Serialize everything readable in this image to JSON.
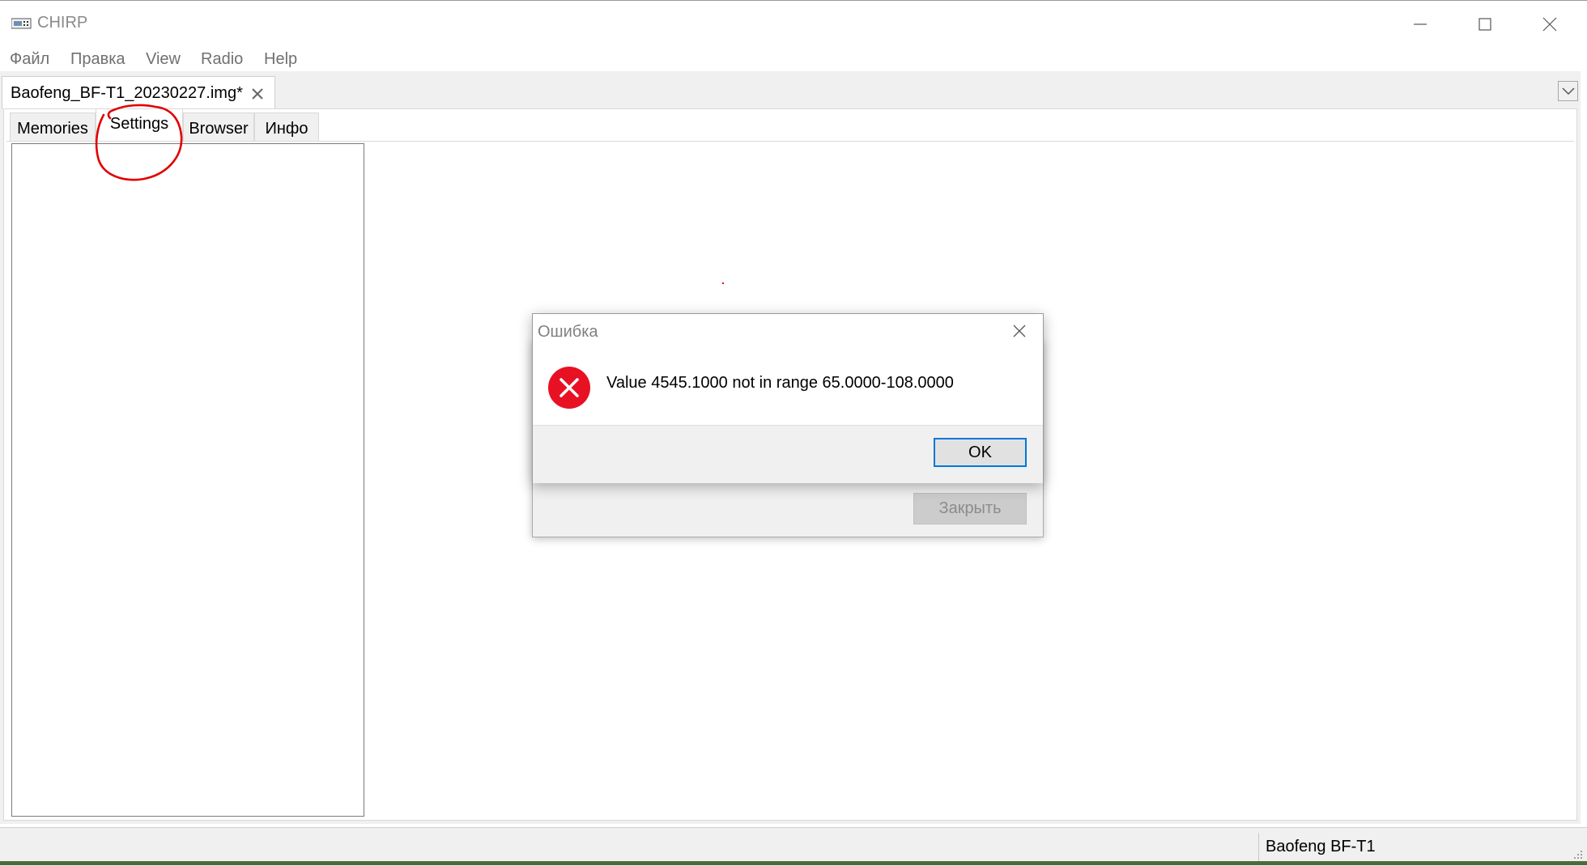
{
  "window": {
    "title": "CHIRP"
  },
  "menu": [
    "Файл",
    "Правка",
    "View",
    "Radio",
    "Help"
  ],
  "file_tab": {
    "label": "Baofeng_BF-T1_20230227.img*"
  },
  "subtabs": [
    "Memories",
    "Settings",
    "Browser",
    "Инфо"
  ],
  "active_subtab": "Settings",
  "status": {
    "radio": "Baofeng BF-T1"
  },
  "back_dialog": {
    "close_label": "Закрыть"
  },
  "error_dialog": {
    "title": "Ошибка",
    "message": "Value 4545.1000 not in range 65.0000-108.0000",
    "ok_label": "OK"
  },
  "colors": {
    "accent": "#0078d7",
    "error": "#e81123",
    "annotation": "#e00000"
  }
}
